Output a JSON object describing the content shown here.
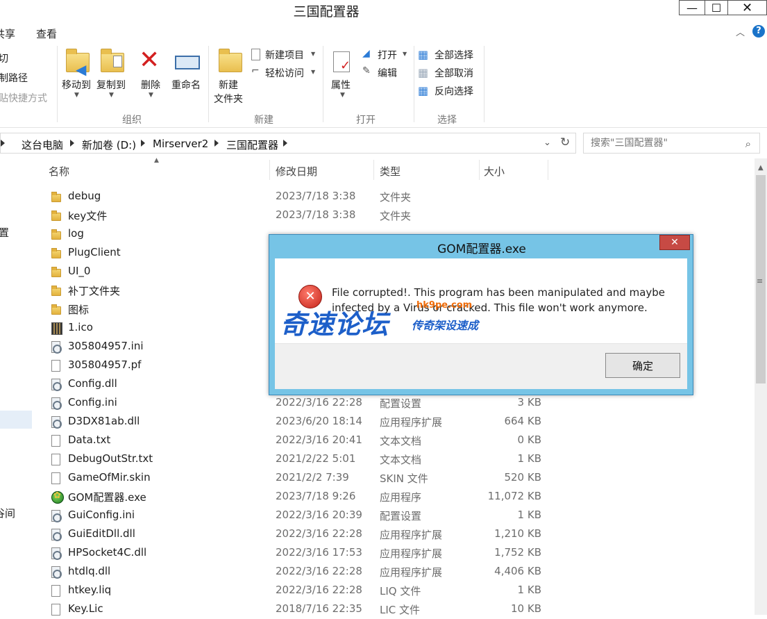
{
  "window": {
    "title": "三国配置器",
    "minimize_glyph": "—",
    "maximize_glyph": "☐",
    "close_glyph": "✕"
  },
  "ribbon_tabs": [
    "共享",
    "查看"
  ],
  "ribbon": {
    "clipboard_partial": [
      "切",
      "制路径",
      "贴快捷方式"
    ],
    "organize": {
      "label": "组织",
      "move_to": "移动到",
      "copy_to": "复制到",
      "delete": "删除",
      "rename": "重命名"
    },
    "new": {
      "label": "新建",
      "new_folder_line1": "新建",
      "new_folder_line2": "文件夹",
      "new_item": "新建项目",
      "easy_access": "轻松访问"
    },
    "open": {
      "label": "打开",
      "properties": "属性",
      "open": "打开",
      "edit": "编辑"
    },
    "select": {
      "label": "选择",
      "select_all": "全部选择",
      "select_none": "全部取消",
      "invert": "反向选择"
    }
  },
  "address": {
    "crumbs": [
      "这台电脑",
      "新加卷 (D:)",
      "Mirserver2",
      "三国配置器"
    ]
  },
  "search": {
    "placeholder": "搜索\"三国配置器\""
  },
  "columns": {
    "name": "名称",
    "date": "修改日期",
    "type": "类型",
    "size": "大小"
  },
  "nav_partial": [
    "置",
    "谷间"
  ],
  "files": [
    {
      "name": "debug",
      "date": "2023/7/18 3:38",
      "type": "文件夹",
      "size": "",
      "icon": "folder"
    },
    {
      "name": "key文件",
      "date": "2023/7/18 3:38",
      "type": "文件夹",
      "size": "",
      "icon": "folder"
    },
    {
      "name": "log",
      "date": "",
      "type": "",
      "size": "",
      "icon": "folder"
    },
    {
      "name": "PlugClient",
      "date": "",
      "type": "",
      "size": "",
      "icon": "folder"
    },
    {
      "name": "UI_0",
      "date": "",
      "type": "",
      "size": "",
      "icon": "folder"
    },
    {
      "name": "补丁文件夹",
      "date": "",
      "type": "",
      "size": "",
      "icon": "folder"
    },
    {
      "name": "图标",
      "date": "",
      "type": "",
      "size": "",
      "icon": "folder"
    },
    {
      "name": "1.ico",
      "date": "",
      "type": "",
      "size": "",
      "icon": "ico"
    },
    {
      "name": "305804957.ini",
      "date": "",
      "type": "",
      "size": "",
      "icon": "gear"
    },
    {
      "name": "305804957.pf",
      "date": "",
      "type": "",
      "size": "",
      "icon": "file"
    },
    {
      "name": "Config.dll",
      "date": "",
      "type": "",
      "size": "",
      "icon": "gear"
    },
    {
      "name": "Config.ini",
      "date": "2022/3/16 22:28",
      "type": "配置设置",
      "size": "3 KB",
      "icon": "gear"
    },
    {
      "name": "D3DX81ab.dll",
      "date": "2023/6/20 18:14",
      "type": "应用程序扩展",
      "size": "664 KB",
      "icon": "gear"
    },
    {
      "name": "Data.txt",
      "date": "2022/3/16 20:41",
      "type": "文本文档",
      "size": "0 KB",
      "icon": "file"
    },
    {
      "name": "DebugOutStr.txt",
      "date": "2021/2/22 5:01",
      "type": "文本文档",
      "size": "1 KB",
      "icon": "file"
    },
    {
      "name": "GameOfMir.skin",
      "date": "2021/2/2 7:39",
      "type": "SKIN 文件",
      "size": "520 KB",
      "icon": "file"
    },
    {
      "name": "GOM配置器.exe",
      "date": "2023/7/18 9:26",
      "type": "应用程序",
      "size": "11,072 KB",
      "icon": "exe"
    },
    {
      "name": "GuiConfig.ini",
      "date": "2022/3/16 20:39",
      "type": "配置设置",
      "size": "1 KB",
      "icon": "gear"
    },
    {
      "name": "GuiEditDll.dll",
      "date": "2022/3/16 22:28",
      "type": "应用程序扩展",
      "size": "1,210 KB",
      "icon": "gear"
    },
    {
      "name": "HPSocket4C.dll",
      "date": "2022/3/16 17:53",
      "type": "应用程序扩展",
      "size": "1,752 KB",
      "icon": "gear"
    },
    {
      "name": "htdlq.dll",
      "date": "2022/3/16 22:28",
      "type": "应用程序扩展",
      "size": "4,406 KB",
      "icon": "gear"
    },
    {
      "name": "htkey.liq",
      "date": "2022/3/16 22:28",
      "type": "LIQ 文件",
      "size": "1 KB",
      "icon": "file"
    },
    {
      "name": "Key.Lic",
      "date": "2018/7/16 22:35",
      "type": "LIC 文件",
      "size": "10 KB",
      "icon": "file"
    }
  ],
  "dialog": {
    "title": "GOM配置器.exe",
    "close_glyph": "✕",
    "message": "File corrupted!. This program has been manipulated and maybe infected by a Virus or cracked. This file won't work anymore.",
    "ok": "确定",
    "error_glyph": "✕"
  },
  "watermark": {
    "main": "奇速论坛",
    "sub": "传奇架设速成",
    "url": "hk9pe.com"
  },
  "colors": {
    "dialog_frame": "#76c4e6",
    "dialog_close": "#c74a44",
    "watermark_blue": "#1d5fc9",
    "folder_yellow": "#e9bf4f"
  }
}
